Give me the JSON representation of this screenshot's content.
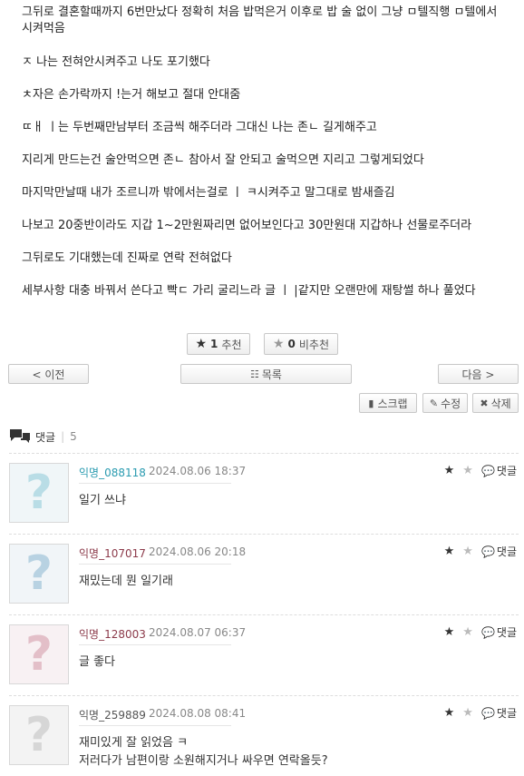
{
  "post": {
    "paragraphs": [
      "그뒤로 결혼할때까지 6번만났다 정확히 처음 밥먹은거 이후로 밥 술 없이 그냥 ㅁ텔직행 ㅁ텔에서 시켜먹음",
      "ㅈ   나는 전혀안시켜주고 나도 포기했다",
      "ㅊ자은 손가락까지   !는거 해보고 절대 안대줌",
      "ㄸㅐ ㅣ는 두번째만남부터 조금씩 해주더라 그대신 나는 존ㄴ   길게해주고",
      "지리게 만드는건 술안먹으면 존ㄴ   참아서 잘 안되고 술먹으면 지리고 그렇게되었다",
      "마지막만날때 내가 조르니까 밖에서는걸로 ㅣ ㅋ시켜주고 말그대로 밤새즐김",
      "나보고 20중반이라도 지갑 1~2만원짜리면 없어보인다고 30만원대 지갑하나 선물로주더라",
      "그뒤로도 기대했는데 진짜로 연락 전혀없다",
      "세부사항 대충 바꿔서 쓴다고 빡ㄷ 가리 굴리느라 글 ㅣ   |같지만 오랜만에 재탕썰 하나 풀었다"
    ]
  },
  "votes": {
    "up_label": "추천",
    "up_count": "1",
    "down_label": "비추천",
    "down_count": "0"
  },
  "nav": {
    "prev": "< 이전",
    "list": "목록",
    "next": "다음 >"
  },
  "actions": {
    "scrap": "스크랩",
    "edit": "수정",
    "delete": "삭제"
  },
  "comments_header": {
    "label": "댓글",
    "count": "5"
  },
  "colors": {
    "accent": "#2a9bb0",
    "name_teal": "#2a9bb0",
    "name_red": "#8c3a4a",
    "name_gray": "#555555"
  },
  "comments": [
    {
      "name": "익명_088118",
      "date": "2024.08.06 18:37",
      "lines": [
        "일기 쓰냐"
      ],
      "reply": "댓글",
      "avatar": "question-teal"
    },
    {
      "name": "익명_107017",
      "date": "2024.08.06 20:18",
      "lines": [
        "재밌는데 뭔 일기래"
      ],
      "reply": "댓글",
      "avatar": "question-blue"
    },
    {
      "name": "익명_128003",
      "date": "2024.08.07 06:37",
      "lines": [
        "글 좋다"
      ],
      "reply": "댓글",
      "avatar": "question-pink"
    },
    {
      "name": "익명_259889",
      "date": "2024.08.08 08:41",
      "lines": [
        "재미있게 잘 읽었음 ㅋ",
        "저러다가 남편이랑 소원해지거나 싸우면 연락올듯?"
      ],
      "reply": "댓글",
      "avatar": "question-gray"
    }
  ]
}
